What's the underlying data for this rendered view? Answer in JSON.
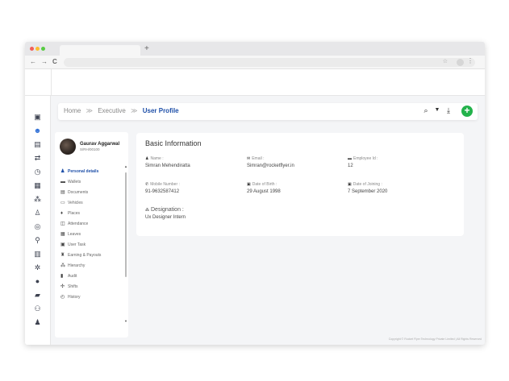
{
  "browser": {
    "new_tab_label": "+",
    "back_glyph": "←",
    "forward_glyph": "→",
    "reload_glyph": "C",
    "star_glyph": "☆",
    "menu_glyph": "⋮"
  },
  "sidebar": {
    "icons": [
      "dashboard-icon",
      "user-group-icon",
      "documents-icon",
      "transfer-icon",
      "timer-icon",
      "table-icon",
      "team-icon",
      "inventory-icon",
      "coins-icon",
      "location-icon",
      "report-icon",
      "settings-icon",
      "map-pin-icon",
      "chat-icon",
      "org-icon",
      "person-icon"
    ],
    "active_index": 1
  },
  "breadcrumb": {
    "home": "Home",
    "separator": "≫",
    "section": "Executive",
    "current": "User Profile"
  },
  "toolbar": {
    "search_glyph": "⌕",
    "filter_glyph": "▼",
    "download_glyph": "⤓",
    "add_glyph": "+"
  },
  "profile": {
    "name": "Gaurav Aggarwal",
    "id": "S/RH/00100",
    "menu": [
      {
        "label": "Personal details",
        "icon": "person-icon",
        "active": true
      },
      {
        "label": "Wallets",
        "icon": "wallet-icon",
        "active": false
      },
      {
        "label": "Documents",
        "icon": "documents-icon",
        "active": false
      },
      {
        "label": "Vehicles",
        "icon": "vehicle-icon",
        "active": false
      },
      {
        "label": "Places",
        "icon": "place-icon",
        "active": false
      },
      {
        "label": "Attendance",
        "icon": "attendance-icon",
        "active": false
      },
      {
        "label": "Leaves",
        "icon": "leaves-icon",
        "active": false
      },
      {
        "label": "User Task",
        "icon": "task-icon",
        "active": false
      },
      {
        "label": "Earning & Payouts",
        "icon": "earning-icon",
        "active": false
      },
      {
        "label": "Hierarchy",
        "icon": "hierarchy-icon",
        "active": false
      },
      {
        "label": "Audit",
        "icon": "audit-icon",
        "active": false
      },
      {
        "label": "Shifts",
        "icon": "shifts-icon",
        "active": false
      },
      {
        "label": "History",
        "icon": "history-icon",
        "active": false
      }
    ]
  },
  "basic_info": {
    "title": "Basic Information",
    "fields": [
      {
        "label": "Name :",
        "value": "Simran Mehendiratta",
        "icon": "person-icon"
      },
      {
        "label": "Email :",
        "value": "Simran@rocketflyer.in",
        "icon": "mail-icon"
      },
      {
        "label": "Employee Id :",
        "value": "12",
        "icon": "id-card-icon"
      },
      {
        "label": "Mobile Number :",
        "value": "91-9632587412",
        "icon": "phone-icon"
      },
      {
        "label": "Date of Birth :",
        "value": "29 August 1998",
        "icon": "calendar-icon"
      },
      {
        "label": "Date of Joining :",
        "value": "7 September 2020",
        "icon": "calendar-icon"
      },
      {
        "label": "Designation :",
        "value": "Ux Designer Intern",
        "icon": "group-icon"
      }
    ]
  },
  "footer": {
    "text": "Copyright © Rocket Flyer Technology Private Limited  |  All Rights Reserved"
  }
}
